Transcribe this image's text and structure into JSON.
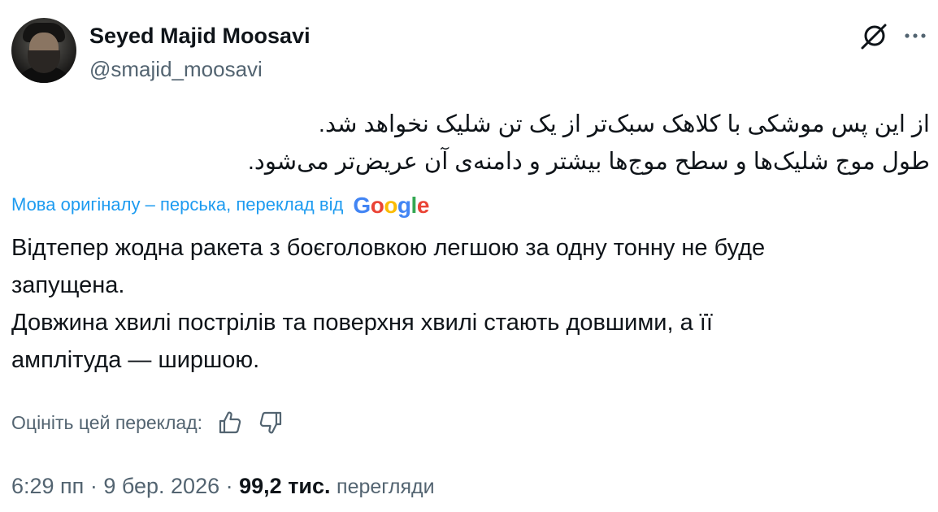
{
  "author": {
    "display_name": "Seyed Majid Moosavi",
    "handle": "@smajid_moosavi",
    "avatar_icon": "profile-photo"
  },
  "header_actions": {
    "grok_icon": "grok-icon",
    "more_icon": "more-icon"
  },
  "original_text": {
    "lines": [
      "از این پس موشکی با کلاهک سبک‌تر از یک تن شلیک نخواهد شد.",
      "طول موج شلیک‌ها و سطح موج‌ها بیشتر و دامنه‌ی آن عریض‌تر می‌شود."
    ]
  },
  "translation_note": {
    "text": "Мова оригіналу – перська, переклад від",
    "provider": "Google"
  },
  "translated_text": {
    "lines": [
      "Відтепер жодна ракета з боєголовкою легшою за одну тонну не буде",
      "запущена.",
      "Довжина хвилі пострілів та поверхня хвилі стають довшими, а її",
      "амплітуда — ширшою."
    ]
  },
  "rate_translation": {
    "label": "Оцініть цей переклад:",
    "like_icon": "thumbs-up-icon",
    "dislike_icon": "thumbs-down-icon"
  },
  "meta": {
    "time": "6:29 пп",
    "separator": "·",
    "date": "9 бер. 2026",
    "views_count": "99,2 тис.",
    "views_label": "перегляди"
  },
  "colors": {
    "text": "#0f1419",
    "secondary": "#536471",
    "link": "#1d9bf0"
  }
}
